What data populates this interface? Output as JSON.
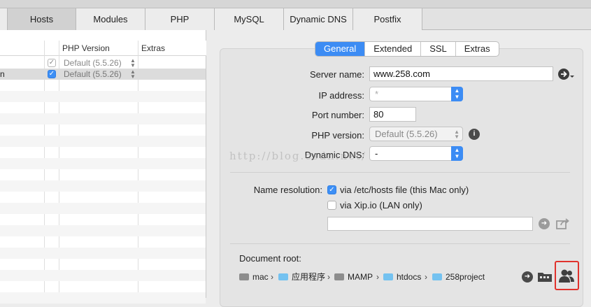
{
  "tabs": [
    {
      "label": "Hosts",
      "active": true
    },
    {
      "label": "Modules"
    },
    {
      "label": "PHP"
    },
    {
      "label": "MySQL"
    },
    {
      "label": "Dynamic DNS"
    },
    {
      "label": "Postfix"
    }
  ],
  "table": {
    "headers": {
      "php_version": "PHP Version",
      "extras": "Extras"
    },
    "rows": [
      {
        "name": "",
        "enabled": true,
        "php_version": "Default (5.5.26)"
      },
      {
        "name": "n",
        "enabled": true,
        "php_version": "Default (5.5.26)"
      }
    ]
  },
  "settings_tabs": [
    "General",
    "Extended",
    "SSL",
    "Extras"
  ],
  "settings_active_tab": "General",
  "form": {
    "server_name_label": "Server name:",
    "server_name_value": "www.258.com",
    "ip_address_label": "IP address:",
    "ip_address_value": "*",
    "port_label": "Port number:",
    "port_value": "80",
    "php_version_label": "PHP version:",
    "php_version_value": "Default (5.5.26)",
    "dynamic_dns_label": "Dynamic DNS:",
    "dynamic_dns_value": "-",
    "name_resolution_label": "Name resolution:",
    "resolution_hosts_label": "via /etc/hosts file (this Mac only)",
    "resolution_hosts_checked": true,
    "resolution_xip_label": "via Xip.io (LAN only)",
    "resolution_xip_checked": false,
    "xip_value": "",
    "document_root_label": "Document root:",
    "document_root_path": [
      "mac",
      "应用程序",
      "MAMP",
      "htdocs",
      "258project"
    ]
  },
  "watermark": "http://blog.csdn.net/",
  "icons": [
    "go-arrow-menu-icon",
    "info-icon",
    "arrow-right-icon",
    "share-icon",
    "folder-browse-icon",
    "users-icon"
  ]
}
